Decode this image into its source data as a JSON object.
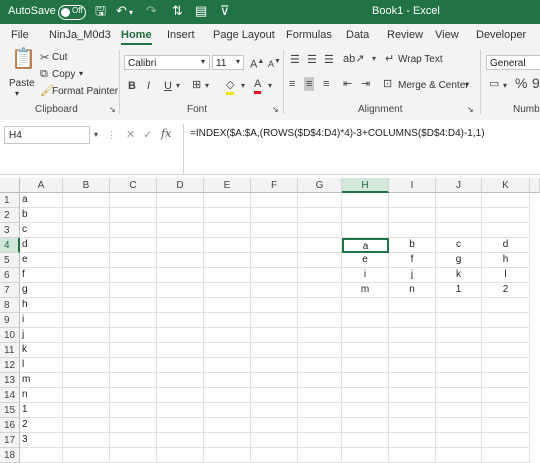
{
  "titlebar": {
    "autosave_label": "AutoSave",
    "autosave_state": "Off",
    "doc_title": "Book1  -  Excel"
  },
  "tabs": [
    "File",
    "NinJa_M0d3",
    "Home",
    "Insert",
    "Page Layout",
    "Formulas",
    "Data",
    "Review",
    "View",
    "Developer"
  ],
  "active_tab": "Home",
  "ribbon": {
    "clipboard": {
      "paste": "Paste",
      "cut": "Cut",
      "copy": "Copy",
      "format_painter": "Format Painter",
      "label": "Clipboard"
    },
    "font": {
      "name": "Calibri",
      "size": "11",
      "label": "Font"
    },
    "alignment": {
      "wrap_text": "Wrap Text",
      "merge_center": "Merge & Center",
      "label": "Alignment"
    },
    "number": {
      "format": "General",
      "percent": "%",
      "label": "Numbe"
    }
  },
  "formula_bar": {
    "name_box": "H4",
    "formula": "=INDEX($A:$A,(ROWS($D$4:D4)*4)-3+COLUMNS($D$4:D4)-1,1)"
  },
  "sheet": {
    "columns": [
      "A",
      "B",
      "C",
      "D",
      "E",
      "F",
      "G",
      "H",
      "I",
      "J",
      "K"
    ],
    "rows": [
      "1",
      "2",
      "3",
      "4",
      "5",
      "6",
      "7",
      "8",
      "9",
      "10",
      "11",
      "12",
      "13",
      "14",
      "15",
      "16",
      "17",
      "18"
    ],
    "active_cell": "H4",
    "column_a": [
      "a",
      "b",
      "c",
      "d",
      "e",
      "f",
      "g",
      "h",
      "i",
      "j",
      "k",
      "l",
      "m",
      "n",
      "1",
      "2",
      "3",
      ""
    ],
    "output_block": [
      [
        "a",
        "b",
        "c",
        "d"
      ],
      [
        "e",
        "f",
        "g",
        "h"
      ],
      [
        "i",
        "j",
        "k",
        "l"
      ],
      [
        "m",
        "n",
        "1",
        "2"
      ]
    ]
  }
}
